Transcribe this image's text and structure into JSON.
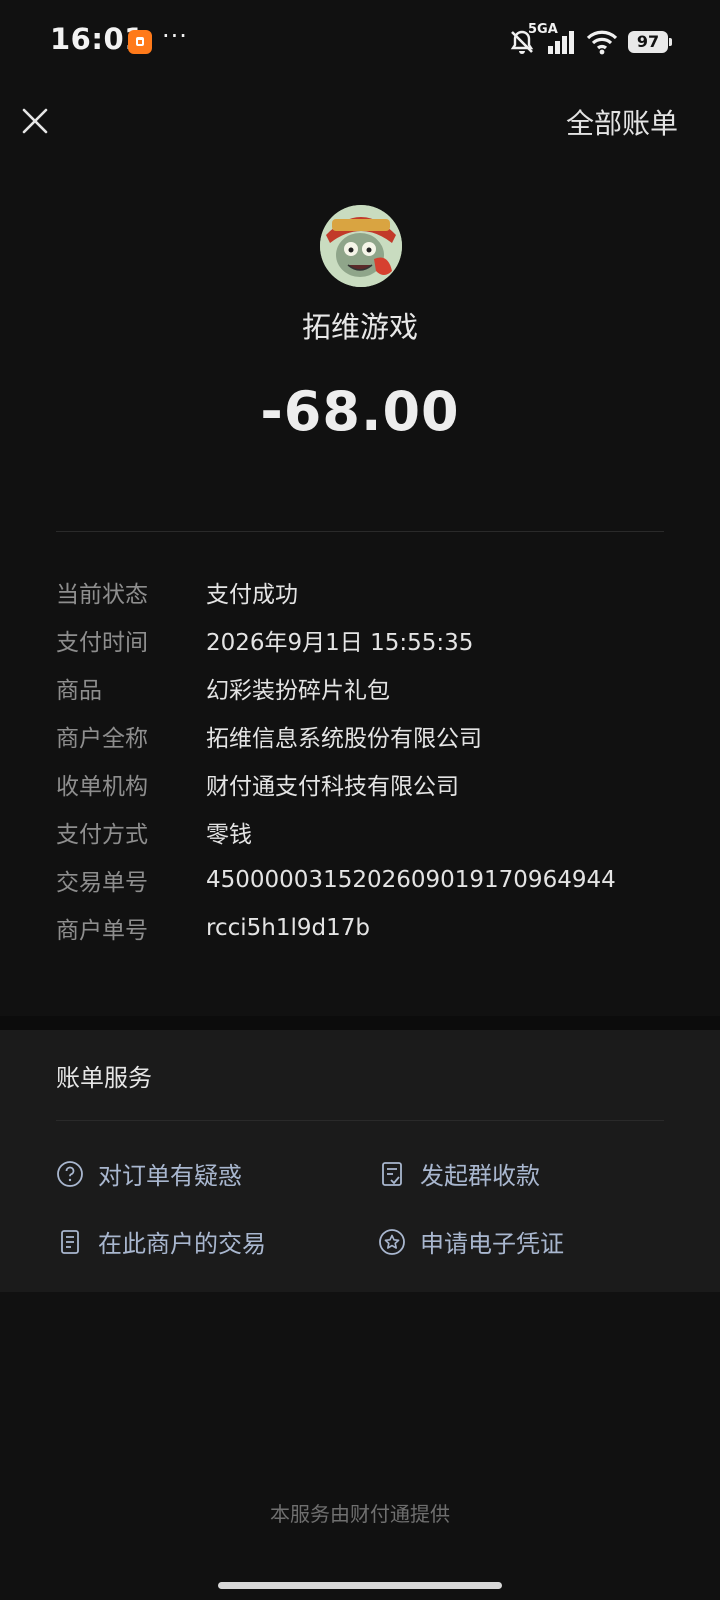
{
  "status_bar": {
    "time": "16:01",
    "more": "···",
    "network": "5GA",
    "battery": "97",
    "icons": [
      "app-notification-icon",
      "bell-muted-icon",
      "signal-icon",
      "wifi-icon",
      "battery-icon"
    ]
  },
  "header": {
    "close_icon": "close-icon",
    "all_bills": "全部账单"
  },
  "merchant": {
    "name": "拓维游戏",
    "amount": "-68.00",
    "avatar_icon": "zombie-avatar-icon"
  },
  "details": [
    {
      "label": "当前状态",
      "value": "支付成功"
    },
    {
      "label": "支付时间",
      "value": "2026年9月1日 15:55:35"
    },
    {
      "label": "商品",
      "value": "幻彩装扮碎片礼包"
    },
    {
      "label": "商户全称",
      "value": "拓维信息系统股份有限公司"
    },
    {
      "label": "收单机构",
      "value": "财付通支付科技有限公司"
    },
    {
      "label": "支付方式",
      "value": "零钱"
    },
    {
      "label": "交易单号",
      "value": "4500000315202609019170964944"
    },
    {
      "label": "商户单号",
      "value": "rcci5h1l9d17b"
    }
  ],
  "services": {
    "title": "账单服务",
    "items": [
      {
        "label": "对订单有疑惑",
        "icon": "question-circle-icon"
      },
      {
        "label": "发起群收款",
        "icon": "group-collect-icon"
      },
      {
        "label": "在此商户的交易",
        "icon": "document-icon"
      },
      {
        "label": "申请电子凭证",
        "icon": "star-badge-icon"
      }
    ]
  },
  "footer": "本服务由财付通提供",
  "colors": {
    "background": "#111111",
    "card": "#1b1b1b",
    "service_link": "#a9b7cf",
    "label": "#8e8e8e"
  }
}
